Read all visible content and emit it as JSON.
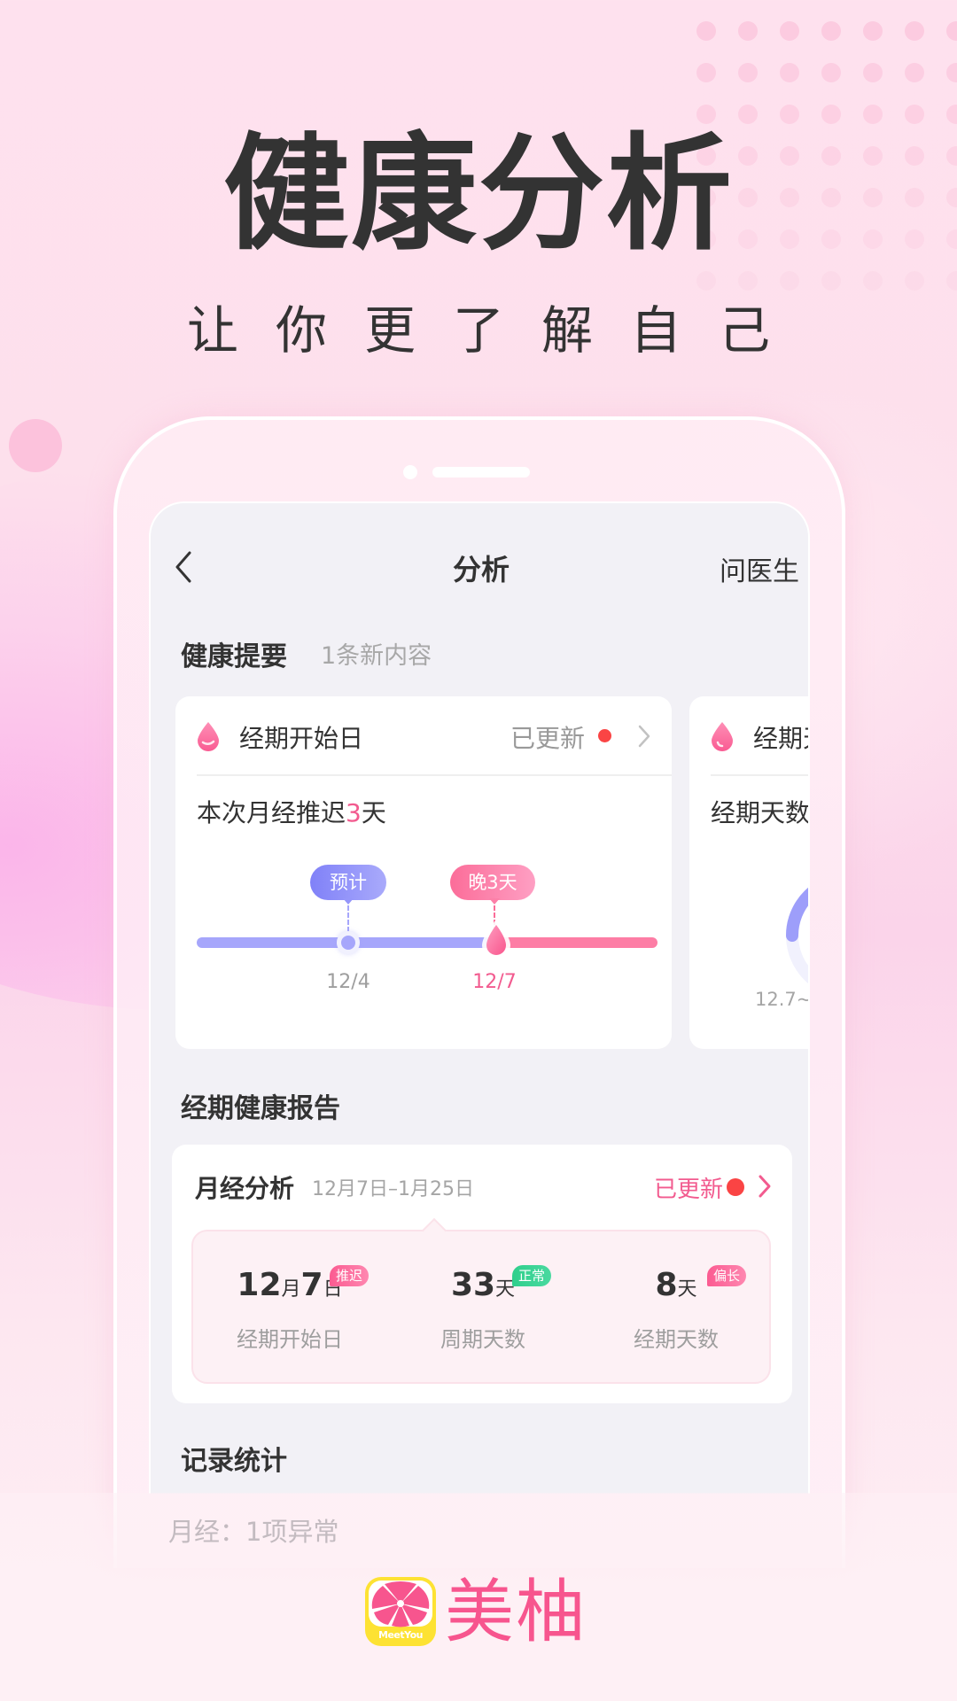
{
  "hero": {
    "title": "健康分析",
    "subtitle": "让你更了解自己"
  },
  "nav": {
    "back_icon": "chevron-left-icon",
    "title": "分析",
    "right_action": "问医生"
  },
  "health_summary": {
    "title": "健康提要",
    "subtitle": "1条新内容",
    "cards": [
      {
        "icon": "blood-drop-icon",
        "title": "经期开始日",
        "status": "已更新",
        "message_prefix": "本次月经推迟",
        "message_highlight": "3",
        "message_suffix": "天",
        "timeline": {
          "expected_label": "预计",
          "expected_date": "12/4",
          "actual_label": "晚3天",
          "actual_date": "12/7"
        }
      },
      {
        "icon": "blood-drop-icon",
        "title": "经期天数",
        "message": "经期天数",
        "range_label": "12.7~"
      }
    ]
  },
  "report": {
    "section_title": "经期健康报告",
    "card_title": "月经分析",
    "date_range": "12月7日–1月25日",
    "status": "已更新",
    "stats": [
      {
        "value": "12",
        "unit1": "月",
        "value2": "7",
        "unit2": "日",
        "label": "经期开始日",
        "tag": "推迟",
        "tag_color": "pink"
      },
      {
        "value": "33",
        "unit1": "天",
        "label": "周期天数",
        "tag": "正常",
        "tag_color": "green"
      },
      {
        "value": "8",
        "unit1": "天",
        "label": "经期天数",
        "tag": "偏长",
        "tag_color": "pink"
      }
    ]
  },
  "records": {
    "section_title": "记录统计",
    "peek": "月经：1项异常"
  },
  "brand": {
    "name": "美柚",
    "logo_text": "MeetYou"
  },
  "colors": {
    "accent_pink": "#f25b8f",
    "accent_blue": "#a6a6fb",
    "status_red": "#fa4444",
    "tag_green": "#2fcf8c",
    "brand_yellow": "#fde233"
  }
}
